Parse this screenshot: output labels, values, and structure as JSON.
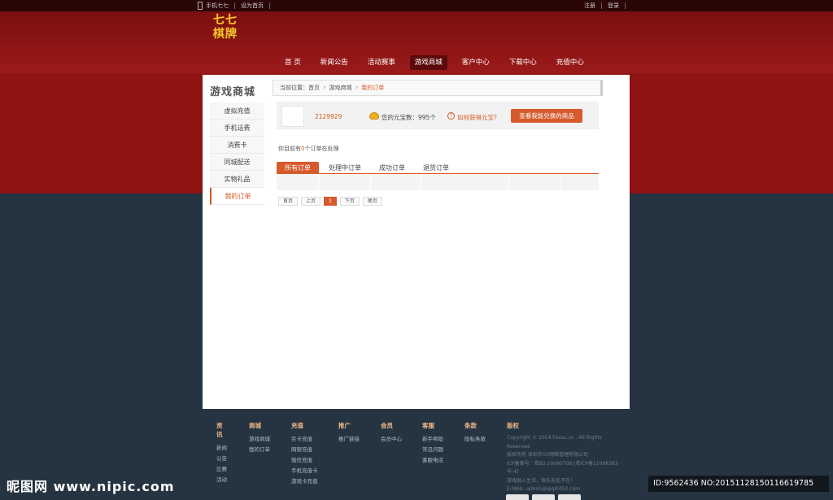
{
  "topbar": {
    "mobile_label": "手机七七",
    "homepage_label": "设为首页",
    "register_label": "注册",
    "login_label": "登录"
  },
  "logo_text": "七七棋牌",
  "nav": [
    {
      "label": "首 页"
    },
    {
      "label": "新闻公告"
    },
    {
      "label": "活动赛事"
    },
    {
      "label": "游戏商城"
    },
    {
      "label": "客户中心"
    },
    {
      "label": "下载中心"
    },
    {
      "label": "充值中心"
    }
  ],
  "sidebar": {
    "title": "游戏商城",
    "items": [
      {
        "label": "虚拟充值"
      },
      {
        "label": "手机话费"
      },
      {
        "label": "消费卡"
      },
      {
        "label": "同城配送"
      },
      {
        "label": "实物礼品"
      },
      {
        "label": "我的订单"
      }
    ]
  },
  "breadcrumb": {
    "prefix": "当前位置：",
    "home": "首页",
    "section": "游戏商城",
    "current": "我的订单"
  },
  "user": {
    "id": "2129929",
    "balance_text": "您的元宝数：995个",
    "help_text": "如何获得元宝?",
    "exchange_button": "查看我能兑换的商品"
  },
  "orders": {
    "count_prefix": "你目前有",
    "count": "0",
    "count_suffix": "个订单在处理",
    "tabs": [
      {
        "label": "所有订单"
      },
      {
        "label": "处理中订单"
      },
      {
        "label": "成功订单"
      },
      {
        "label": "退货订单"
      }
    ]
  },
  "pager": {
    "first": "首页",
    "prev": "上页",
    "current": "1",
    "next": "下页",
    "last": "尾页"
  },
  "footer": {
    "news": {
      "title": "资讯",
      "items": [
        "新闻",
        "公告",
        "比赛",
        "活动"
      ]
    },
    "mall": {
      "title": "商城",
      "items": [
        "游戏商城",
        "我的订单"
      ]
    },
    "recharge": {
      "title": "充值",
      "items": [
        "实卡充值",
        "网银充值",
        "微信充值",
        "手机充值卡",
        "游戏卡充值"
      ]
    },
    "promo": {
      "title": "推广",
      "items": [
        "推广链接"
      ]
    },
    "member": {
      "title": "会员",
      "items": [
        "会员中心"
      ]
    },
    "service": {
      "title": "客服",
      "items": [
        "新手帮助",
        "常见问题",
        "客服电话"
      ]
    },
    "terms": {
      "title": "条款",
      "items": [
        "隐私条款"
      ]
    },
    "copyright": {
      "title": "版权",
      "items": [
        "Copyright © 2014 Foxuc.cn . All Rights",
        "Reserved.",
        "版权所有 深圳市XX网络管理有限公司",
        "ICP备案号：粤B2-20080708 [粤ICP备11008383",
        "号-4]",
        "游戏融入生活，快乐无处不在！",
        "E-MAIL: admin@qiqi0452.com"
      ]
    }
  },
  "watermark": {
    "site": "昵图网 www.nipic.com",
    "id_text": "ID:9562436 NO:20151128150116619785"
  }
}
